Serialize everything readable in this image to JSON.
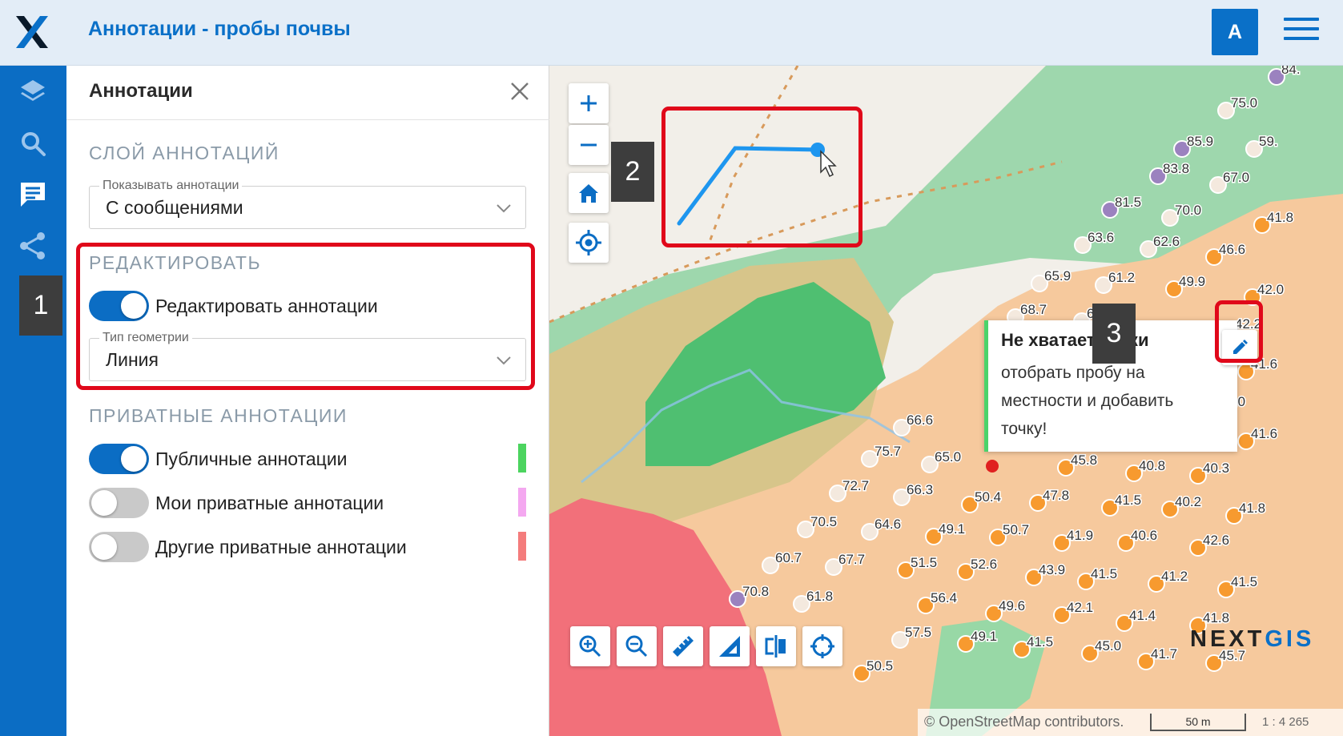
{
  "header": {
    "title": "Аннотации - пробы почвы",
    "avatar_letter": "A",
    "brand_color": "#0a70c8"
  },
  "nav": {
    "items": [
      "layers-icon",
      "search-icon",
      "annotations-icon",
      "share-icon",
      "print-icon"
    ]
  },
  "callouts": [
    "1",
    "2",
    "3"
  ],
  "panel": {
    "title": "Аннотации",
    "layer_section": {
      "title": "СЛОЙ АННОТАЦИЙ",
      "show_label": "Показывать аннотации",
      "show_value": "С сообщениями"
    },
    "edit_section": {
      "title": "РЕДАКТИРОВАТЬ",
      "toggle_label": "Редактировать аннотации",
      "toggle_on": true,
      "geometry_label": "Тип геометрии",
      "geometry_value": "Линия"
    },
    "private_section": {
      "title": "ПРИВАТНЫЕ АННОТАЦИИ",
      "items": [
        {
          "label": "Публичные аннотации",
          "on": true,
          "color": "#4cd45f"
        },
        {
          "label": "Мои приватные аннотации",
          "on": false,
          "color": "#f4a8f0"
        },
        {
          "label": "Другие приватные аннотации",
          "on": false,
          "color": "#f47c7c"
        }
      ]
    }
  },
  "map": {
    "tooltip": {
      "title": "Не хватает точки",
      "body": "отобрать пробу на местности и добавить точку!"
    },
    "brand": {
      "part1": "NEXT",
      "part2": "GIS"
    },
    "attribution": "© OpenStreetMap contributors.",
    "scale_label": "50 m",
    "scale_ratio": "1 : 4 265",
    "points": [
      {
        "v": "84.",
        "t": "p"
      },
      {
        "v": "75.0",
        "t": "w"
      },
      {
        "v": "85.9",
        "t": "p"
      },
      {
        "v": "59.",
        "t": "w"
      },
      {
        "v": "83.8",
        "t": "p"
      },
      {
        "v": "67.0",
        "t": "w"
      },
      {
        "v": "81.5",
        "t": "p"
      },
      {
        "v": "70.0",
        "t": "w"
      },
      {
        "v": "41.8",
        "t": "o"
      },
      {
        "v": "63.6",
        "t": "w"
      },
      {
        "v": "62.6",
        "t": "w"
      },
      {
        "v": "46.6",
        "t": "o"
      },
      {
        "v": "65.9",
        "t": "w"
      },
      {
        "v": "61.2",
        "t": "w"
      },
      {
        "v": "49.9",
        "t": "o"
      },
      {
        "v": "42.0",
        "t": "o"
      },
      {
        "v": "68.7",
        "t": "w"
      },
      {
        "v": "64.8",
        "t": "w"
      },
      {
        "v": "42.2",
        "t": "o"
      },
      {
        "v": "41.6",
        "t": "o"
      },
      {
        "v": "41.0",
        "t": "o"
      },
      {
        "v": "66.6",
        "t": "w"
      },
      {
        "v": "41.6",
        "t": "o"
      },
      {
        "v": "75.7",
        "t": "w"
      },
      {
        "v": "65.0",
        "t": "w"
      },
      {
        "v": "45.8",
        "t": "o"
      },
      {
        "v": "40.8",
        "t": "o"
      },
      {
        "v": "40.3",
        "t": "o"
      },
      {
        "v": "72.7",
        "t": "w"
      },
      {
        "v": "66.3",
        "t": "w"
      },
      {
        "v": "50.4",
        "t": "o"
      },
      {
        "v": "47.8",
        "t": "o"
      },
      {
        "v": "41.5",
        "t": "o"
      },
      {
        "v": "40.2",
        "t": "o"
      },
      {
        "v": "41.8",
        "t": "o"
      },
      {
        "v": "70.5",
        "t": "w"
      },
      {
        "v": "64.6",
        "t": "w"
      },
      {
        "v": "49.1",
        "t": "o"
      },
      {
        "v": "50.7",
        "t": "o"
      },
      {
        "v": "41.9",
        "t": "o"
      },
      {
        "v": "40.6",
        "t": "o"
      },
      {
        "v": "42.6",
        "t": "o"
      },
      {
        "v": "60.7",
        "t": "w"
      },
      {
        "v": "67.7",
        "t": "w"
      },
      {
        "v": "51.5",
        "t": "o"
      },
      {
        "v": "52.6",
        "t": "o"
      },
      {
        "v": "43.9",
        "t": "o"
      },
      {
        "v": "41.5",
        "t": "o"
      },
      {
        "v": "41.2",
        "t": "o"
      },
      {
        "v": "41.5",
        "t": "o"
      },
      {
        "v": "70.8",
        "t": "p"
      },
      {
        "v": "61.8",
        "t": "w"
      },
      {
        "v": "56.4",
        "t": "o"
      },
      {
        "v": "49.6",
        "t": "o"
      },
      {
        "v": "42.1",
        "t": "o"
      },
      {
        "v": "41.4",
        "t": "o"
      },
      {
        "v": "41.8",
        "t": "o"
      },
      {
        "v": "57.5",
        "t": "w"
      },
      {
        "v": "49.1",
        "t": "o"
      },
      {
        "v": "41.5",
        "t": "o"
      },
      {
        "v": "45.0",
        "t": "o"
      },
      {
        "v": "41.7",
        "t": "o"
      },
      {
        "v": "45.7",
        "t": "o"
      },
      {
        "v": "50.5",
        "t": "o"
      }
    ]
  }
}
